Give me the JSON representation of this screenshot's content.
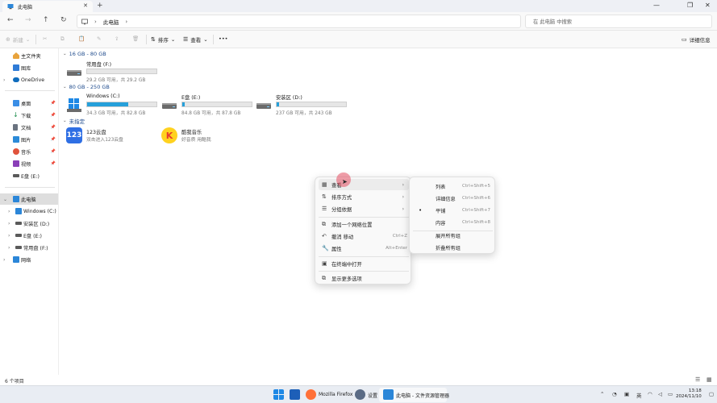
{
  "window": {
    "tab_title": "此电脑",
    "close_tab": "✕",
    "new_tab": "+",
    "minimize": "—",
    "maximize": "❐",
    "close": "✕"
  },
  "addressbar": {
    "back": "←",
    "forward": "→",
    "up": "↑",
    "refresh": "↻",
    "breadcrumb": "此电脑",
    "separator": "›",
    "search_placeholder": "在 此电脑 中搜索"
  },
  "commandbar": {
    "new_label": "新建",
    "sort_label": "排序",
    "view_label": "查看",
    "more": "•••",
    "details_label": "详细信息"
  },
  "sidebar": {
    "items": [
      {
        "label": "主文件夹",
        "icon": "home-icon",
        "color": "#e8a33c"
      },
      {
        "label": "图库",
        "icon": "gallery-icon",
        "color": "#2f7bd6"
      },
      {
        "label": "OneDrive",
        "icon": "cloud-icon",
        "color": "#0f6cbd"
      },
      {
        "label": "桌面",
        "icon": "desktop-icon",
        "color": "#3a8ee6"
      },
      {
        "label": "下载",
        "icon": "download-icon",
        "color": "#1f8f4e"
      },
      {
        "label": "文档",
        "icon": "document-icon",
        "color": "#6a7380"
      },
      {
        "label": "图片",
        "icon": "pictures-icon",
        "color": "#2b8ad8"
      },
      {
        "label": "音乐",
        "icon": "music-icon",
        "color": "#e0533c"
      },
      {
        "label": "视频",
        "icon": "video-icon",
        "color": "#8a3fb8"
      },
      {
        "label": "E盘 (E:)",
        "icon": "drive-icon",
        "color": "#5a5a5a"
      },
      {
        "label": "此电脑",
        "icon": "pc-icon",
        "color": "#2b86d8"
      },
      {
        "label": "Windows (C:)",
        "icon": "drive-icon",
        "color": "#5a5a5a"
      },
      {
        "label": "安装区 (D:)",
        "icon": "drive-icon",
        "color": "#5a5a5a"
      },
      {
        "label": "E盘 (E:)",
        "icon": "drive-icon",
        "color": "#5a5a5a"
      },
      {
        "label": "常用盘 (F:)",
        "icon": "drive-icon",
        "color": "#5a5a5a"
      },
      {
        "label": "网络",
        "icon": "network-icon",
        "color": "#2b86d8"
      }
    ]
  },
  "groups": {
    "g1": "16 GB - 80 GB",
    "g2": "80 GB - 250 GB",
    "g3": "未指定"
  },
  "drives": [
    {
      "name": "常用盘 (F:)",
      "info": "29.2 GB 可用，共 29.2 GB",
      "used_fraction": 0.0
    },
    {
      "name": "Windows (C:)",
      "info": "34.3 GB 可用，共 82.8 GB",
      "used_fraction": 0.59
    },
    {
      "name": "E盘 (E:)",
      "info": "84.8 GB 可用，共 87.8 GB",
      "used_fraction": 0.04
    },
    {
      "name": "安装区 (D:)",
      "info": "237 GB 可用，共 243 GB",
      "used_fraction": 0.03
    }
  ],
  "apps": [
    {
      "name": "123云盘",
      "info": "双击进入123云盘",
      "icon_text": "123",
      "color": "#2f6fe4"
    },
    {
      "name": "酷我音乐",
      "info": "好音质 用酷我",
      "icon_text": "K",
      "color": "#ffd21f"
    }
  ],
  "context_menu": {
    "items": [
      {
        "label": "查看",
        "icon": "▦",
        "arrow": "›"
      },
      {
        "label": "排序方式",
        "icon": "⇅",
        "arrow": "›"
      },
      {
        "label": "分组依据",
        "icon": "☰",
        "arrow": "›"
      },
      {
        "label": "添加一个网络位置",
        "icon": "⧉"
      },
      {
        "label": "撤消 移动",
        "icon": "↶",
        "shortcut": "Ctrl+Z"
      },
      {
        "label": "属性",
        "icon": "🔧",
        "shortcut": "Alt+Enter"
      },
      {
        "label": "在终端中打开",
        "icon": "▣"
      },
      {
        "label": "显示更多选项",
        "icon": "⧉"
      }
    ]
  },
  "submenu": {
    "items": [
      {
        "label": "列表",
        "shortcut": "Ctrl+Shift+5"
      },
      {
        "label": "详细信息",
        "shortcut": "Ctrl+Shift+6"
      },
      {
        "label": "平铺",
        "shortcut": "Ctrl+Shift+7",
        "selected": "•"
      },
      {
        "label": "内容",
        "shortcut": "Ctrl+Shift+8"
      },
      {
        "label": "展开所有组"
      },
      {
        "label": "折叠所有组"
      }
    ]
  },
  "status": {
    "count": "6 个项目"
  },
  "taskbar": {
    "firefox_label": "Mozilla Firefox",
    "settings_label": "设置",
    "explorer_label": "此电脑 - 文件资源管理器",
    "ime": "英",
    "time": "13:18",
    "date": "2024/11/10"
  }
}
